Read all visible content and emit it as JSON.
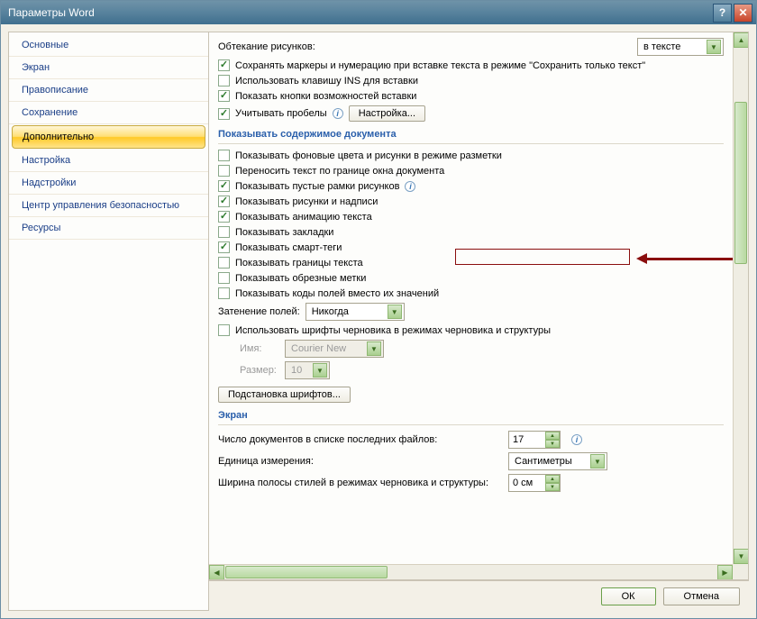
{
  "window": {
    "title": "Параметры Word"
  },
  "sidebar": {
    "items": [
      {
        "label": "Основные"
      },
      {
        "label": "Экран"
      },
      {
        "label": "Правописание"
      },
      {
        "label": "Сохранение"
      },
      {
        "label": "Дополнительно"
      },
      {
        "label": "Настройка"
      },
      {
        "label": "Надстройки"
      },
      {
        "label": "Центр управления безопасностью"
      },
      {
        "label": "Ресурсы"
      }
    ],
    "active_index": 4
  },
  "content": {
    "top_row": {
      "label": "Обтекание рисунков:",
      "select_value": "в тексте"
    },
    "paste_checks": [
      {
        "checked": true,
        "label": "Сохранять маркеры и нумерацию при вставке текста в режиме \"Сохранить только текст\""
      },
      {
        "checked": false,
        "label": "Использовать клавишу INS для вставки"
      },
      {
        "checked": true,
        "label": "Показать кнопки возможностей вставки"
      },
      {
        "checked": true,
        "label": "Учитывать пробелы"
      }
    ],
    "settings_btn": "Настройка...",
    "section1": "Показывать содержимое документа",
    "doc_checks": [
      {
        "checked": false,
        "label": "Показывать фоновые цвета и рисунки в режиме разметки"
      },
      {
        "checked": false,
        "label": "Переносить текст по границе окна документа"
      },
      {
        "checked": true,
        "label": "Показывать пустые рамки рисунков"
      },
      {
        "checked": true,
        "label": "Показывать рисунки и надписи"
      },
      {
        "checked": true,
        "label": "Показывать анимацию текста"
      },
      {
        "checked": false,
        "label": "Показывать закладки"
      },
      {
        "checked": true,
        "label": "Показывать смарт-теги"
      },
      {
        "checked": false,
        "label": "Показывать границы текста"
      },
      {
        "checked": false,
        "label": "Показывать обрезные метки"
      },
      {
        "checked": false,
        "label": "Показывать коды полей вместо их значений"
      }
    ],
    "shading_label": "Затенение полей:",
    "shading_value": "Никогда",
    "draft_font_check": {
      "checked": false,
      "label": "Использовать шрифты черновика в режимах черновика и структуры"
    },
    "font_name_label": "Имя:",
    "font_name_value": "Courier New",
    "font_size_label": "Размер:",
    "font_size_value": "10",
    "font_sub_btn": "Подстановка шрифтов...",
    "section2": "Экран",
    "recent_label": "Число документов в списке последних файлов:",
    "recent_value": "17",
    "units_label": "Единица измерения:",
    "units_value": "Сантиметры",
    "style_width_label": "Ширина полосы стилей в режимах черновика и структуры:",
    "style_width_value": "0 см"
  },
  "footer": {
    "ok": "ОК",
    "cancel": "Отмена"
  }
}
